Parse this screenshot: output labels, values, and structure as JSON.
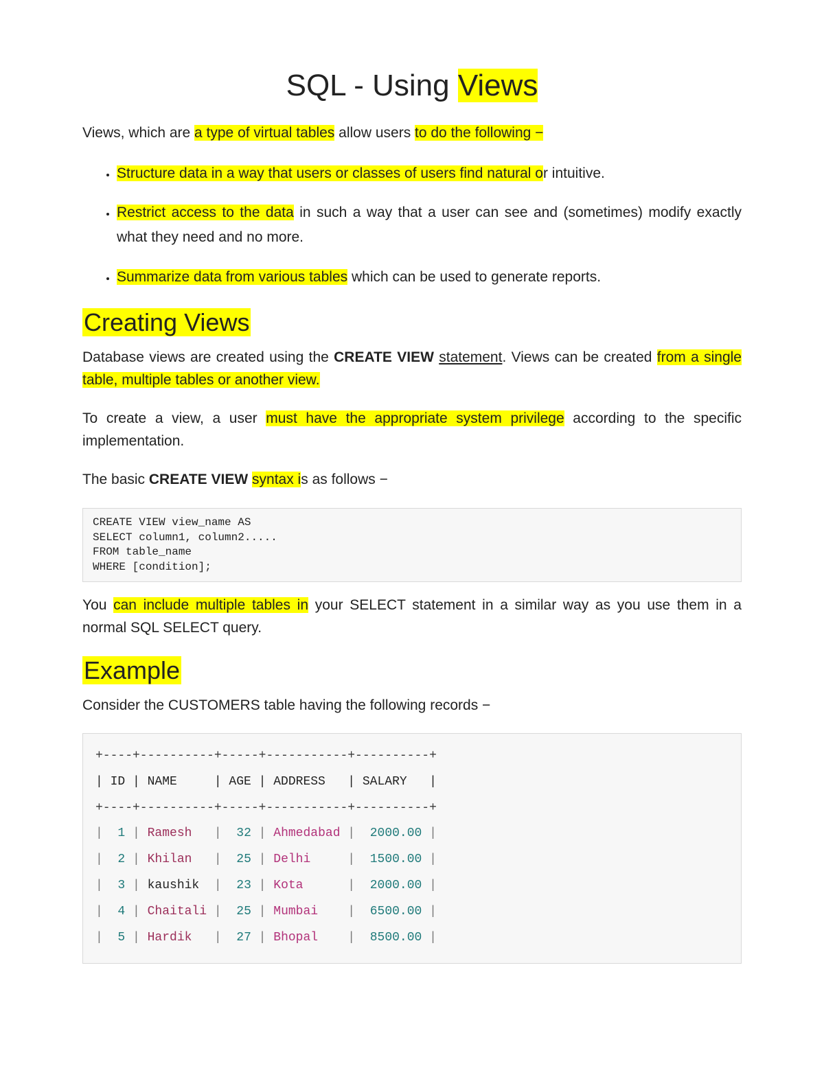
{
  "title": {
    "pre": "SQL - Using ",
    "hl": "Views"
  },
  "intro": {
    "t1": "Views, which are ",
    "h1": "a type of virtual tables",
    "t2": " allow users ",
    "h2": "to do the following −"
  },
  "bullets": [
    {
      "h": "Structure data in a way that users or classes of users find natural o",
      "rest": "r intuitive."
    },
    {
      "h": "Restrict access to the data",
      "rest": " in such a way that a user can see and (sometimes) modify exactly what they need and no more."
    },
    {
      "h": "Summarize data from various tables",
      "rest": " which can be used to generate reports."
    }
  ],
  "h2_creating": "Creating Views",
  "p_creating": {
    "t1": "Database views are created using the ",
    "b1": "CREATE VIEW ",
    "u1": "statement",
    "t2": ". Views can be created ",
    "h1": "from a single table, multiple tables or another view."
  },
  "p_priv": {
    "t1": "To create a view, a user ",
    "h1": "must have the appropriate system privilege",
    "t2": " according to the specific implementation."
  },
  "p_syntax": {
    "t1": "The basic ",
    "b1": "CREATE VIEW",
    "t2": " ",
    "h1": "syntax i",
    "t3": "s as follows −"
  },
  "code1": "CREATE VIEW view_name AS\nSELECT column1, column2.....\nFROM table_name\nWHERE [condition];",
  "p_include": {
    "t1": "You ",
    "h1": "can include multiple tables in",
    "t2": " your SELECT statement in a similar way as you use them in a normal SQL SELECT query."
  },
  "h2_example": "Example",
  "p_example": "Consider the CUSTOMERS table having the following records −",
  "table": {
    "sep": "+----+----------+-----+-----------+----------+",
    "hdr1": "| ID | NAME     | AGE | ADDRESS   | SALARY   |",
    "rows": [
      {
        "id": "1",
        "name": "Ramesh  ",
        "age": "32",
        "addr": "Ahmedabad",
        "sal": "2000.00"
      },
      {
        "id": "2",
        "name": "Khilan  ",
        "age": "25",
        "addr": "Delhi    ",
        "sal": "1500.00"
      },
      {
        "id": "3",
        "name": "kaushik ",
        "age": "23",
        "addr": "Kota     ",
        "sal": "2000.00",
        "nameplain": true
      },
      {
        "id": "4",
        "name": "Chaitali",
        "age": "25",
        "addr": "Mumbai   ",
        "sal": "6500.00"
      },
      {
        "id": "5",
        "name": "Hardik  ",
        "age": "27",
        "addr": "Bhopal   ",
        "sal": "8500.00"
      }
    ]
  }
}
